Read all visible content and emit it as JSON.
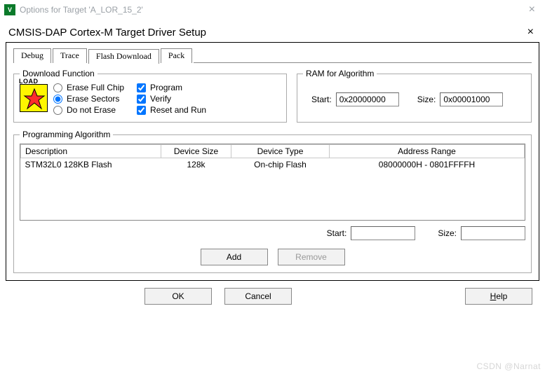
{
  "outer": {
    "title": "Options for Target 'A_LOR_15_2'"
  },
  "inner": {
    "title": "CMSIS-DAP Cortex-M Target Driver Setup"
  },
  "tabs": {
    "debug": "Debug",
    "trace": "Trace",
    "flash": "Flash Download",
    "pack": "Pack"
  },
  "download_function": {
    "legend": "Download Function",
    "erase_full": "Erase Full Chip",
    "erase_sectors": "Erase Sectors",
    "do_not_erase": "Do not Erase",
    "program": "Program",
    "verify": "Verify",
    "reset_run": "Reset and Run"
  },
  "ram": {
    "legend": "RAM for Algorithm",
    "start_label": "Start:",
    "start_value": "0x20000000",
    "size_label": "Size:",
    "size_value": "0x00001000"
  },
  "prog": {
    "legend": "Programming Algorithm",
    "cols": {
      "desc": "Description",
      "dsize": "Device Size",
      "dtype": "Device Type",
      "arange": "Address Range"
    },
    "rows": [
      {
        "desc": "STM32L0 128KB Flash",
        "dsize": "128k",
        "dtype": "On-chip Flash",
        "arange": "08000000H - 0801FFFFH"
      }
    ],
    "start_label": "Start:",
    "start_value": "",
    "size_label": "Size:",
    "size_value": "",
    "add": "Add",
    "remove": "Remove"
  },
  "footer": {
    "ok": "OK",
    "cancel": "Cancel",
    "help": "Help"
  },
  "watermark": "CSDN @Narnat"
}
